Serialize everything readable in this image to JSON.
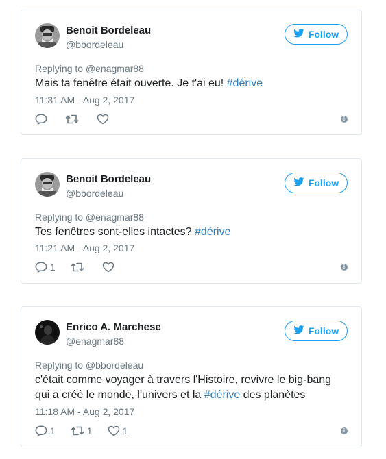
{
  "tweets": [
    {
      "author_name": "Benoit Bordeleau",
      "author_handle": "@bbordeleau",
      "follow_label": "Follow",
      "replying_to": "Replying to @enagmar88",
      "text_before": "Mais ta fenêtre était ouverte. Je t'ai eu! ",
      "hashtag": "#dérive",
      "text_after": "",
      "timestamp": "11:31 AM - Aug 2, 2017",
      "reply_count": "",
      "retweet_count": "",
      "like_count": ""
    },
    {
      "author_name": "Benoit Bordeleau",
      "author_handle": "@bbordeleau",
      "follow_label": "Follow",
      "replying_to": "Replying to @enagmar88",
      "text_before": "Tes fenêtres sont-elles intactes? ",
      "hashtag": "#dérive",
      "text_after": "",
      "timestamp": "11:21 AM - Aug 2, 2017",
      "reply_count": "1",
      "retweet_count": "",
      "like_count": ""
    },
    {
      "author_name": "Enrico A. Marchese",
      "author_handle": "@enagmar88",
      "follow_label": "Follow",
      "replying_to": "Replying to @bbordeleau",
      "text_before": "c'était comme voyager à travers l'Histoire, revivre le big-bang qui a créé le monde, l'univers et la ",
      "hashtag": "#dérive",
      "text_after": " des planètes",
      "timestamp": "11:18 AM - Aug 2, 2017",
      "reply_count": "1",
      "retweet_count": "1",
      "like_count": "1"
    }
  ],
  "colors": {
    "accent": "#1da1f2",
    "hashtag": "#2b7bb9",
    "secondary_text": "#697882",
    "border": "#e1e8ed"
  },
  "icons": [
    "twitter-bird-icon",
    "reply-icon",
    "retweet-icon",
    "heart-icon",
    "info-icon"
  ]
}
